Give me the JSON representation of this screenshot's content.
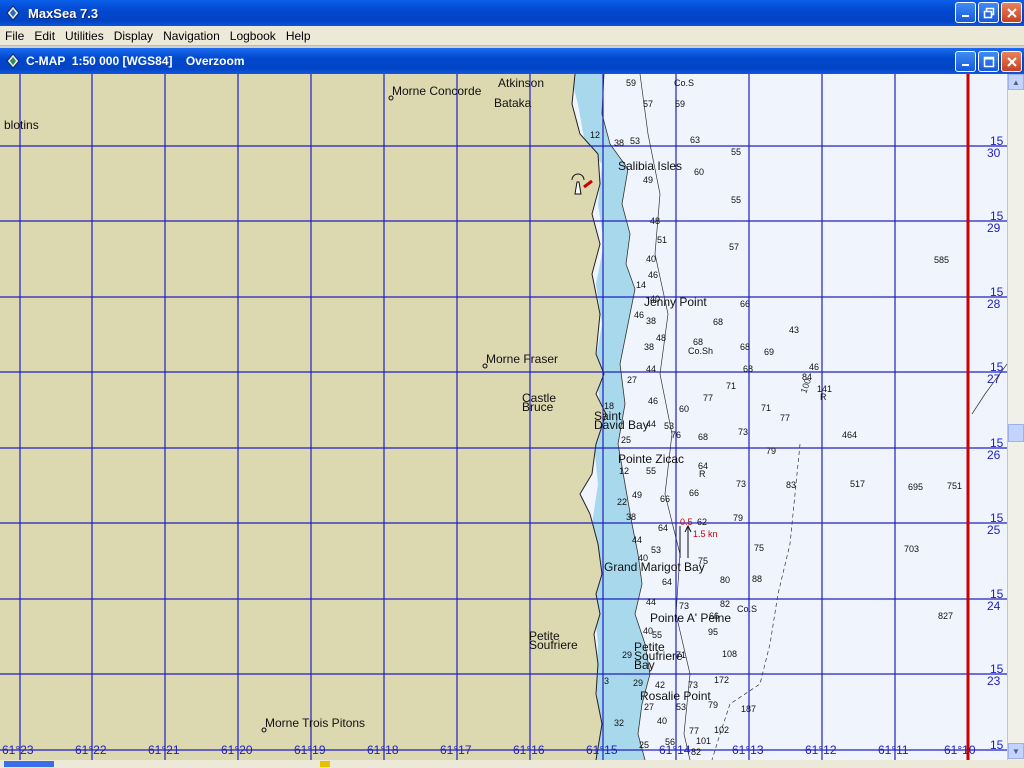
{
  "app": {
    "title": "MaxSea 7.3",
    "icon": "maxsea-app-icon",
    "controls": {
      "minimize": "minimize-icon",
      "restore": "restore-icon",
      "close": "close-icon"
    }
  },
  "menu": {
    "items": [
      "File",
      "Edit",
      "Utilities",
      "Display",
      "Navigation",
      "Logbook",
      "Help"
    ]
  },
  "chart_window": {
    "title": "C-MAP  1:50 000 [WGS84]    Overzoom",
    "icon": "cmap-chart-icon"
  },
  "colors": {
    "land": "#dcd8b0",
    "shallow": "#a8d8ec",
    "deep": "#f0f4fc",
    "grid": "#2020c0",
    "meridian_red": "#cc0000",
    "current_label": "#cc0000"
  },
  "chart": {
    "place_names": [
      "Morne Concorde",
      "Atkinson",
      "Bataka",
      "blotins",
      "Salibia Isles",
      "Jenny Point",
      "Morne Fraser",
      "Castle",
      "Bruce",
      "Saint",
      "David Bay",
      "Pointe Zicac",
      "Grand Marigot Bay",
      "Pointe A' Peine",
      "Petite",
      "Soufriere",
      "Petite",
      "Soufriere",
      "Bay",
      "Rosalie Point",
      "Morne Trois Pitons"
    ],
    "longitude_labels": [
      "61°23",
      "61°22",
      "61°21",
      "61°20",
      "61°19",
      "61°18",
      "61°17",
      "61°16",
      "61°15",
      "61°14",
      "61°13",
      "61°12",
      "61°11",
      "61°10"
    ],
    "latitude_labels": [
      {
        "minute": "15",
        "deg": "30"
      },
      {
        "minute": "15",
        "deg": "29"
      },
      {
        "minute": "15",
        "deg": "28"
      },
      {
        "minute": "15",
        "deg": "27"
      },
      {
        "minute": "15",
        "deg": "26"
      },
      {
        "minute": "15",
        "deg": "25"
      },
      {
        "minute": "15",
        "deg": "24"
      },
      {
        "minute": "15",
        "deg": "23"
      },
      {
        "minute": "15",
        "deg": ""
      }
    ],
    "soundings": [
      "59",
      "Co.S",
      "57",
      "59",
      "63",
      "12",
      "38",
      "53",
      "55",
      "60",
      "49",
      "55",
      "51",
      "48",
      "57",
      "40",
      "46",
      "14",
      "40",
      "46",
      "585",
      "66",
      "38",
      "68",
      "43",
      "48",
      "68",
      "38",
      "Co.Sh",
      "68",
      "69",
      "44",
      "68",
      "27",
      "46",
      "84",
      "141",
      "R",
      "71",
      "77",
      "46",
      "60",
      "18",
      "71",
      "77",
      "44",
      "53",
      "76",
      "68",
      "73",
      "464",
      "25",
      "79",
      "55",
      "64",
      "R",
      "73",
      "83",
      "517",
      "695",
      "751",
      "12",
      "49",
      "66",
      "66",
      "22",
      "38",
      "79",
      "64",
      "0.5",
      "62",
      "1.5 kn",
      "44",
      "53",
      "75",
      "703",
      "40",
      "75",
      "64",
      "80",
      "88",
      "44",
      "73",
      "82",
      "Co.S",
      "66",
      "827",
      "40",
      "55",
      "95",
      "29",
      "108",
      "71",
      "3",
      "29",
      "42",
      "73",
      "172",
      "27",
      "53",
      "79",
      "187",
      "40",
      "77",
      "102",
      "32",
      "25",
      "56",
      "101",
      "82"
    ],
    "contour_label": "100"
  }
}
